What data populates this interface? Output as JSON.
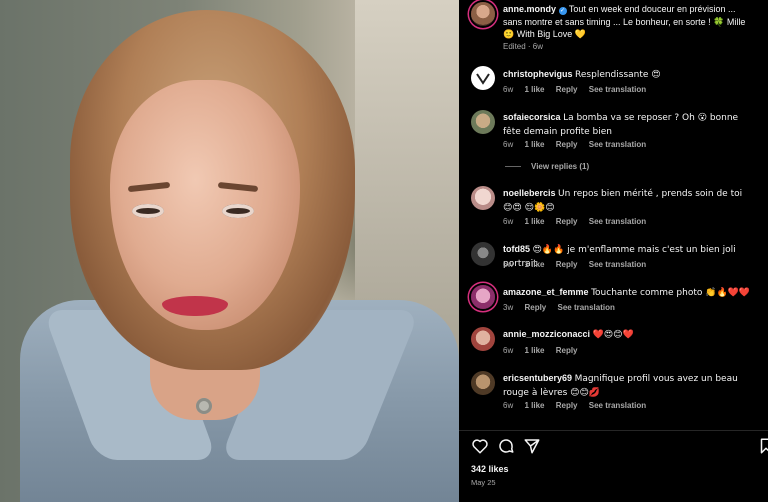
{
  "post": {
    "author": "anne.mondy",
    "caption": "Tout en week end douceur en prévision ... sans montre et sans timing ... Le bonheur, en sorte ! 🍀 Mille 🙂 With Big Love 💛",
    "edited_label": "Edited · 6w"
  },
  "comments": [
    {
      "user": "christophevigus",
      "text": "Resplendissante 😍",
      "time": "6w",
      "likes": "1 like",
      "reply": "Reply",
      "translate": "See translation"
    },
    {
      "user": "sofaiecorsica",
      "text": "La bomba va se reposer ? Oh 😮 bonne fête demain profite bien",
      "time": "6w",
      "likes": "1 like",
      "reply": "Reply",
      "translate": "See translation",
      "view_replies": "View replies (1)"
    },
    {
      "user": "noellebercis",
      "text": "Un repos bien mérité , prends soin de toi 😊😍 😌🌼😊",
      "time": "6w",
      "likes": "1 like",
      "reply": "Reply",
      "translate": "See translation"
    },
    {
      "user": "tofd85",
      "text": "😍🔥🔥 je m'enflamme mais c'est un bien joli portrait",
      "time": "6w",
      "likes": "1 like",
      "reply": "Reply",
      "translate": "See translation"
    },
    {
      "user": "amazone_et_femme",
      "text": "Touchante comme photo 👏🔥❤️❤️",
      "time": "3w",
      "reply": "Reply",
      "translate": "See translation"
    },
    {
      "user": "annie_mozziconacci",
      "text": "❤️😍😊❤️",
      "time": "6w",
      "likes": "1 like",
      "reply": "Reply"
    },
    {
      "user": "ericsentubery69",
      "text": "Magnifique profil vous avez un beau rouge à lèvres 😊😊💋",
      "time": "6w",
      "likes": "1 like",
      "reply": "Reply",
      "translate": "See translation"
    }
  ],
  "footer": {
    "likes": "342 likes",
    "date": "May 25"
  },
  "icons": [
    "heart-icon",
    "comment-icon",
    "share-icon",
    "bookmark-icon",
    "verified-icon"
  ],
  "colors": {
    "story_ring": "#d62f7e",
    "verified": "#3897f0",
    "muted": "#a8a8a8"
  }
}
